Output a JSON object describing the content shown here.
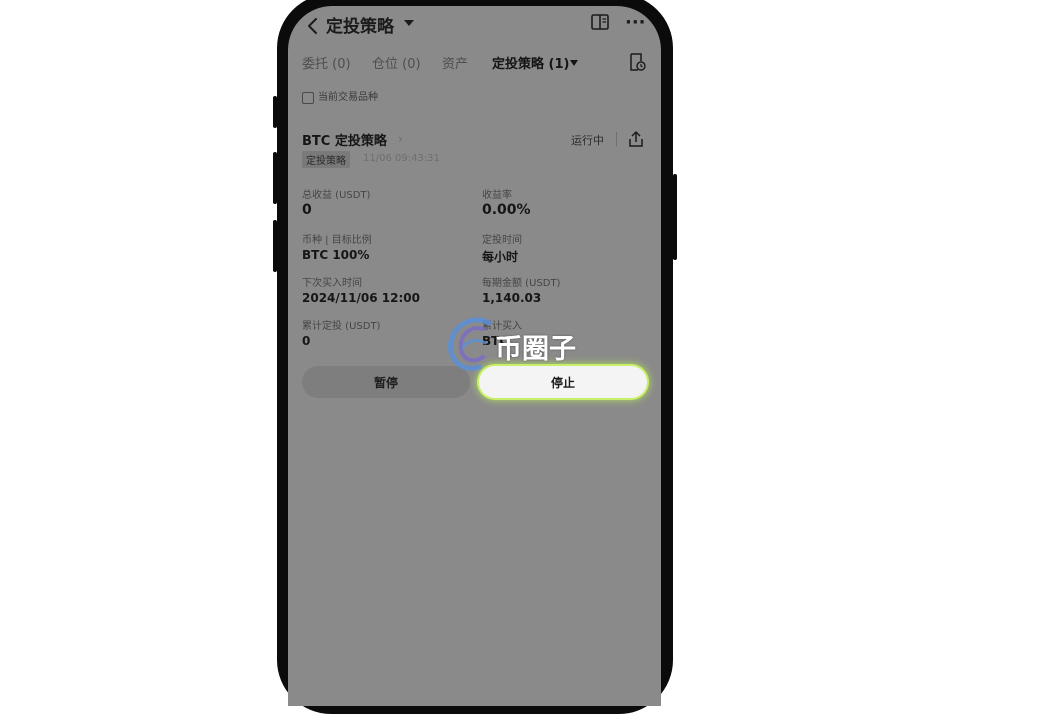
{
  "header": {
    "title": "定投策略",
    "more_symbol": "···"
  },
  "tabs": [
    {
      "label": "委托 (0)"
    },
    {
      "label": "仓位 (0)"
    },
    {
      "label": "资产"
    },
    {
      "label": "定投策略 (1)"
    }
  ],
  "filter": {
    "label": "当前交易品种"
  },
  "card": {
    "title": "BTC 定投策略",
    "status": "运行中",
    "tag": "定投策略",
    "timestamp": "11/06 09:43:31",
    "fields": [
      {
        "label": "总收益 (USDT)",
        "value": "0"
      },
      {
        "label": "收益率",
        "value": "0.00%"
      },
      {
        "label": "币种 | 目标比例",
        "value": "BTC 100%"
      },
      {
        "label": "定投时间",
        "value": "每小时"
      },
      {
        "label": "下次买入时间",
        "value": "2024/11/06 12:00"
      },
      {
        "label": "每期金额 (USDT)",
        "value": "1,140.03"
      },
      {
        "label": "累计定投 (USDT)",
        "value": "0"
      },
      {
        "label": "累计买入",
        "value": "BTC"
      }
    ]
  },
  "buttons": {
    "pause": "暂停",
    "stop": "停止"
  },
  "watermark": {
    "text": "币圈子"
  },
  "colors": {
    "screen_overlay": "#8a8a8a",
    "stop_highlight": "#c7ef6a"
  }
}
